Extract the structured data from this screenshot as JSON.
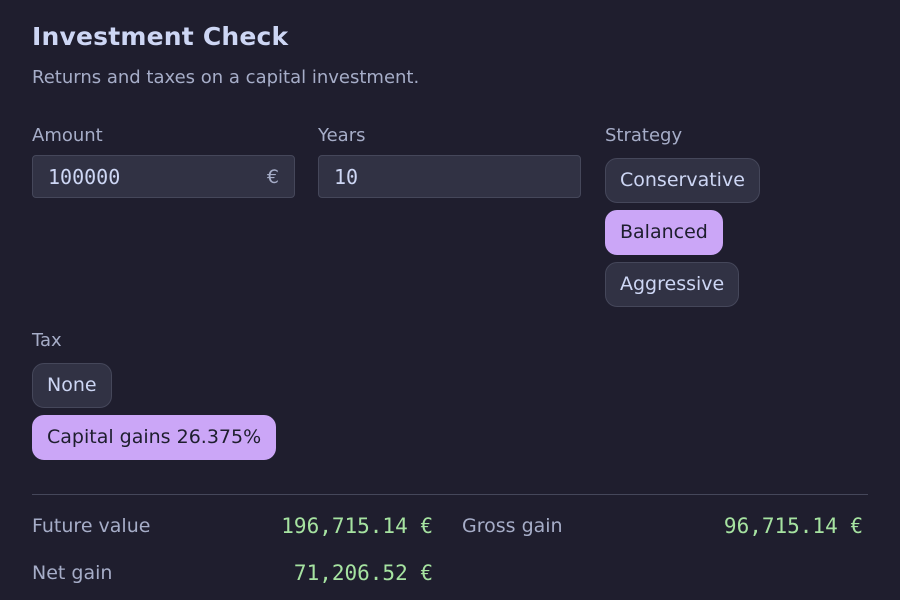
{
  "header": {
    "title": "Investment Check",
    "subtitle": "Returns and taxes on a capital investment."
  },
  "form": {
    "amount": {
      "label": "Amount",
      "value": "100000",
      "suffix": "€"
    },
    "years": {
      "label": "Years",
      "value": "10"
    },
    "strategy": {
      "label": "Strategy",
      "options": [
        "Conservative",
        "Balanced",
        "Aggressive"
      ],
      "selected": "Balanced"
    },
    "tax": {
      "label": "Tax",
      "options": [
        "None",
        "Capital gains 26.375%"
      ],
      "selected": "Capital gains 26.375%"
    }
  },
  "results": {
    "future_value": {
      "label": "Future value",
      "value": "196,715.14 €"
    },
    "gross_gain": {
      "label": "Gross gain",
      "value": "96,715.14 €"
    },
    "net_gain": {
      "label": "Net gain",
      "value": "71,206.52 €"
    }
  },
  "colors": {
    "background": "#1f1e2e",
    "accent": "#cba6f7",
    "result": "#a6e3a1"
  }
}
